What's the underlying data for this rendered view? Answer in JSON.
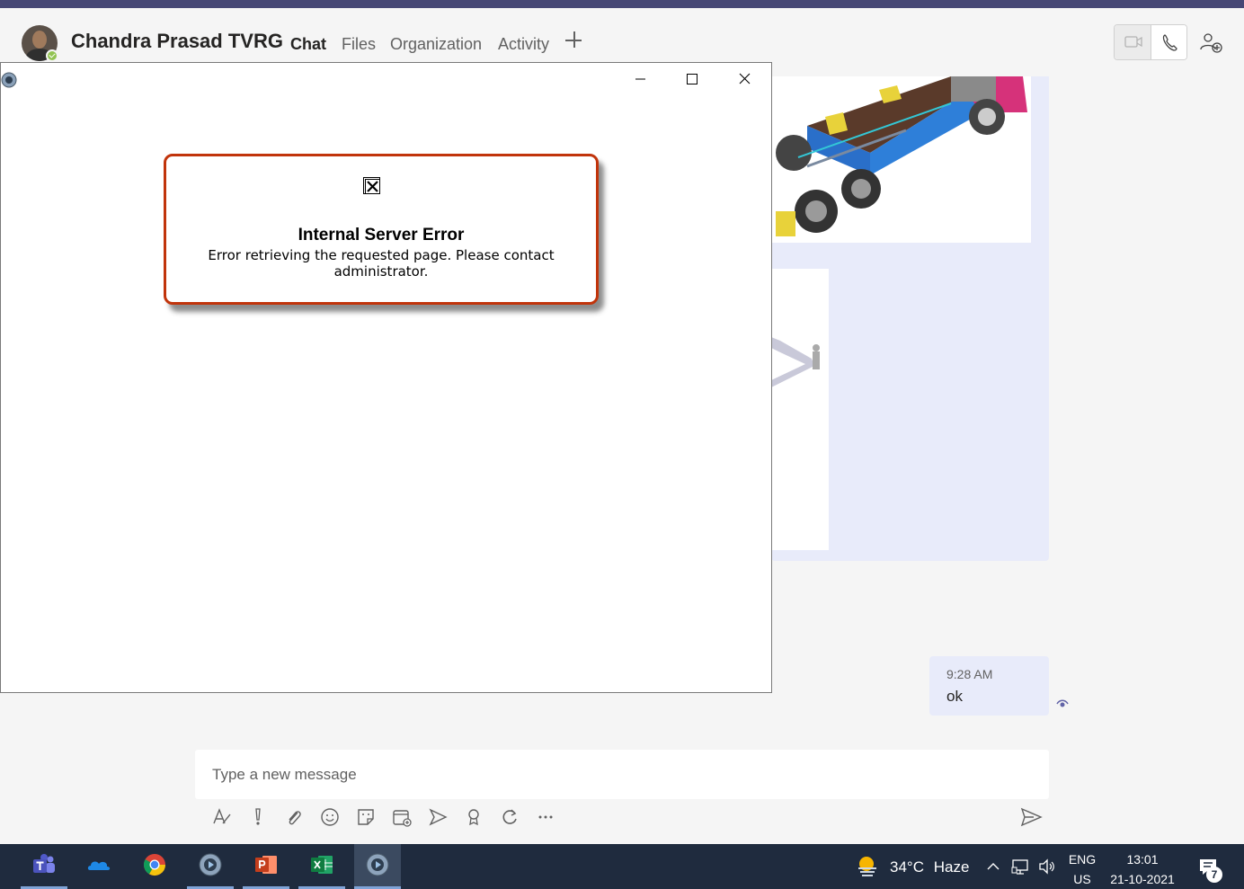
{
  "header": {
    "contact_name": "Chandra Prasad TVRG",
    "tabs": [
      {
        "label": "Chat",
        "active": true
      },
      {
        "label": "Files",
        "active": false
      },
      {
        "label": "Organization",
        "active": false
      },
      {
        "label": "Activity",
        "active": false
      }
    ],
    "add_tab_icon": "plus-icon",
    "presence_status": "available"
  },
  "chat": {
    "messages": [
      {
        "from": "self",
        "time": "9:28 AM",
        "text": "ok"
      }
    ]
  },
  "compose": {
    "placeholder": "Type a new message",
    "tools": [
      "format-icon",
      "important-icon",
      "attach-icon",
      "emoji-icon",
      "sticker-icon",
      "schedule-meeting-icon",
      "stream-icon",
      "praise-icon",
      "loop-icon",
      "more-icon"
    ]
  },
  "popup": {
    "error_title": "Internal Server Error",
    "error_message": "Error retrieving the requested page. Please contact administrator."
  },
  "taskbar": {
    "apps": [
      "teams-icon",
      "onedrive-icon",
      "chrome-icon",
      "media-player-icon",
      "powerpoint-icon",
      "excel-icon",
      "media-player-icon"
    ],
    "weather_temp": "34°C",
    "weather_desc": "Haze",
    "lang_line1": "ENG",
    "lang_line2": "US",
    "time": "13:01",
    "date": "21-10-2021",
    "notification_count": "7"
  },
  "colors": {
    "accent": "#464775",
    "bubble": "#e8ebfa",
    "error_border": "#c1340b",
    "taskbar": "#1f2b3e"
  }
}
